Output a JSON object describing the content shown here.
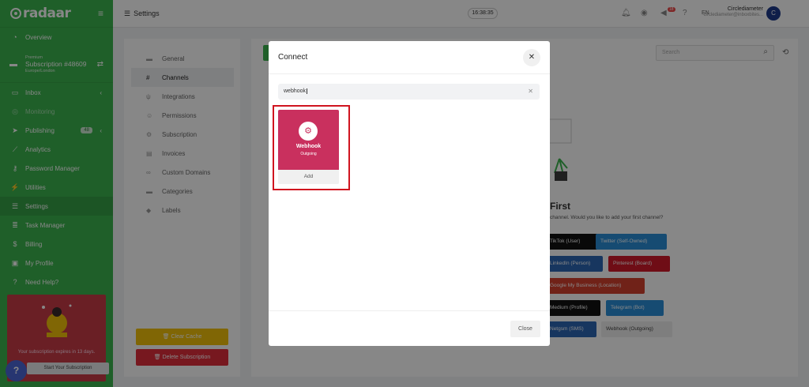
{
  "sidebar": {
    "logo_text": "radaar",
    "subscription": {
      "plan": "Premium",
      "name": "Subscription #48609",
      "location": "Europe/London"
    },
    "items": [
      {
        "label": "Overview",
        "icon": "dashboard-icon"
      },
      {
        "label": "Inbox",
        "icon": "inbox-icon"
      },
      {
        "label": "Monitoring",
        "icon": "monitoring-icon"
      },
      {
        "label": "Publishing",
        "icon": "send-icon",
        "badge": "48"
      },
      {
        "label": "Analytics",
        "icon": "chart-icon"
      },
      {
        "label": "Password Manager",
        "icon": "key-icon"
      },
      {
        "label": "Utilities",
        "icon": "bolt-icon"
      },
      {
        "label": "Settings",
        "icon": "sliders-icon"
      },
      {
        "label": "Task Manager",
        "icon": "list-icon"
      },
      {
        "label": "Billing",
        "icon": "dollar-icon"
      },
      {
        "label": "My Profile",
        "icon": "id-card-icon"
      },
      {
        "label": "Need Help?",
        "icon": "question-icon"
      }
    ],
    "promo": {
      "text": "Your subscription expires in 13 days.",
      "button": "Start Your Subscription"
    },
    "help_fab": "?"
  },
  "topbar": {
    "title": "Settings",
    "clock": "16:38:35",
    "notification_badge": "18",
    "lang": "EN",
    "user_name": "Circlediameter",
    "user_email": "circlediameter@inboxbites...",
    "avatar_letter": "C"
  },
  "settings_nav": {
    "items": [
      {
        "label": "General",
        "icon": "folder-icon"
      },
      {
        "label": "Channels",
        "icon": "hash-icon"
      },
      {
        "label": "Integrations",
        "icon": "plug-icon"
      },
      {
        "label": "Permissions",
        "icon": "users-icon"
      },
      {
        "label": "Subscription",
        "icon": "cog-icon"
      },
      {
        "label": "Invoices",
        "icon": "file-icon"
      },
      {
        "label": "Custom Domains",
        "icon": "link-icon"
      },
      {
        "label": "Categories",
        "icon": "folder-icon"
      },
      {
        "label": "Labels",
        "icon": "tag-icon"
      }
    ],
    "clear_cache": "Clear Cache",
    "delete_subscription": "Delete Subscription"
  },
  "content": {
    "search_placeholder": "Search",
    "empty_title": "First",
    "empty_sub": "channel. Would you like to add your first channel?",
    "channel_buttons": [
      {
        "label": "TikTok (User)",
        "color": "#111111"
      },
      {
        "label": "Twitter (Self-Owned)",
        "color": "#2b8fd8"
      },
      {
        "label": "LinkedIn (Person)",
        "color": "#2d67b4"
      },
      {
        "label": "Pinterest (Board)",
        "color": "#d11a2a"
      },
      {
        "label": "Google My Business (Location)",
        "color": "#d4402f"
      },
      {
        "label": "Medium (Profile)",
        "color": "#111111"
      },
      {
        "label": "Telegram (Bot)",
        "color": "#2b8fd8"
      },
      {
        "label": "Netgsm (SMS)",
        "color": "#2d67b4"
      },
      {
        "label": "Webhook (Outgoing)",
        "color": "#eeeeee"
      }
    ]
  },
  "modal": {
    "title": "Connect",
    "search_value": "webhook",
    "card": {
      "name": "Webhook",
      "sub": "Outgoing",
      "action": "Add",
      "color": "#c9305e"
    },
    "close_label": "Close"
  }
}
